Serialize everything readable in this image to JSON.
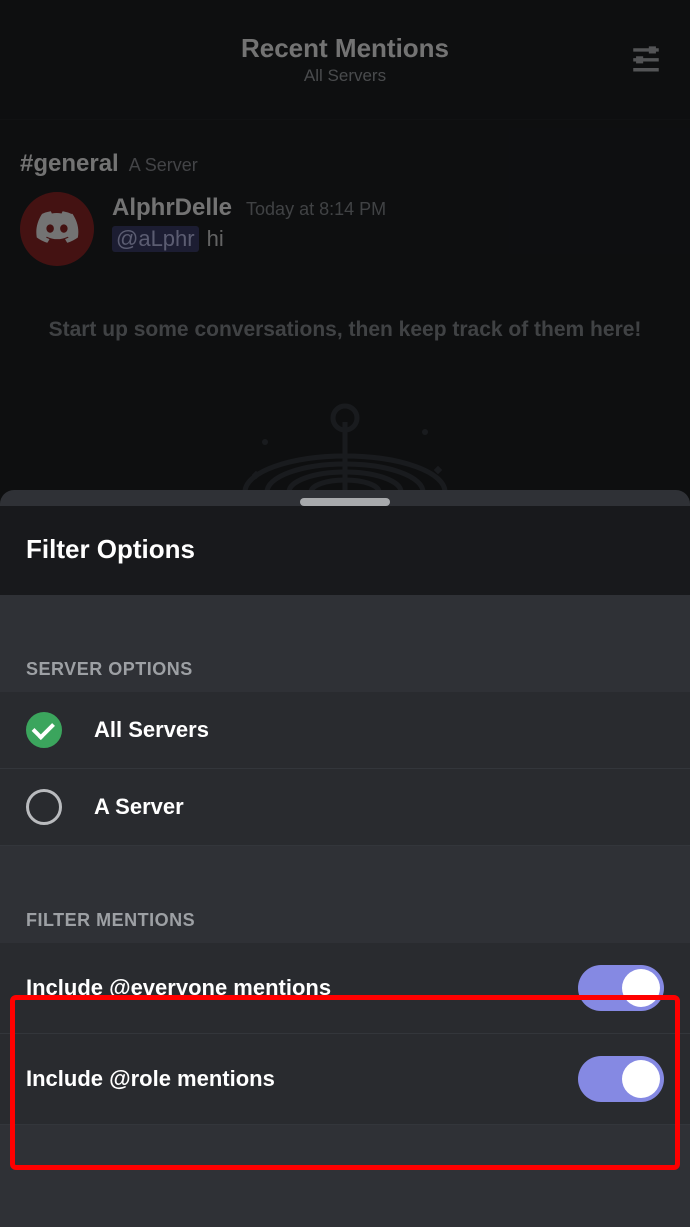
{
  "header": {
    "title": "Recent Mentions",
    "subtitle": "All Servers"
  },
  "channel": {
    "name": "#general",
    "server": "A Server"
  },
  "message": {
    "author": "AlphrDelle",
    "timestamp": "Today at 8:14 PM",
    "mention": "@aLphr",
    "text": "hi"
  },
  "empty_text": "Start up some conversations, then keep track of them here!",
  "sheet": {
    "title": "Filter Options",
    "section_server": "SERVER OPTIONS",
    "servers": [
      {
        "label": "All Servers",
        "checked": true
      },
      {
        "label": "A Server",
        "checked": false
      }
    ],
    "section_filter": "FILTER MENTIONS",
    "toggles": [
      {
        "label": "Include @everyone mentions",
        "on": true
      },
      {
        "label": "Include @role mentions",
        "on": true
      }
    ]
  }
}
